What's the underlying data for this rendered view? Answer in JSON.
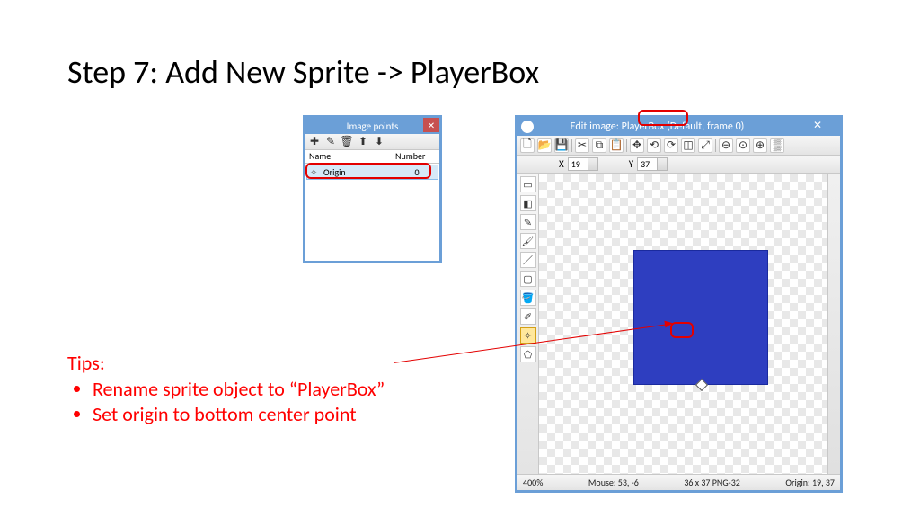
{
  "title": "Step 7: Add New Sprite -> PlayerBox",
  "tips": {
    "label": "Tips:",
    "items": [
      "Rename sprite object to “PlayerBox”",
      "Set origin to bottom center point"
    ]
  },
  "imagePointsWindow": {
    "title": "Image points",
    "headers": {
      "name": "Name",
      "number": "Number"
    },
    "row": {
      "name": "Origin",
      "number": "0"
    }
  },
  "editWindow": {
    "title": "Edit image: PlayerBox (Default, frame 0)",
    "x": {
      "label": "X",
      "value": "19"
    },
    "y": {
      "label": "Y",
      "value": "37"
    },
    "status": {
      "zoom": "400%",
      "mouse": "Mouse: 53, -6",
      "size": "36 x 37  PNG-32",
      "origin": "Origin: 19, 37"
    }
  }
}
